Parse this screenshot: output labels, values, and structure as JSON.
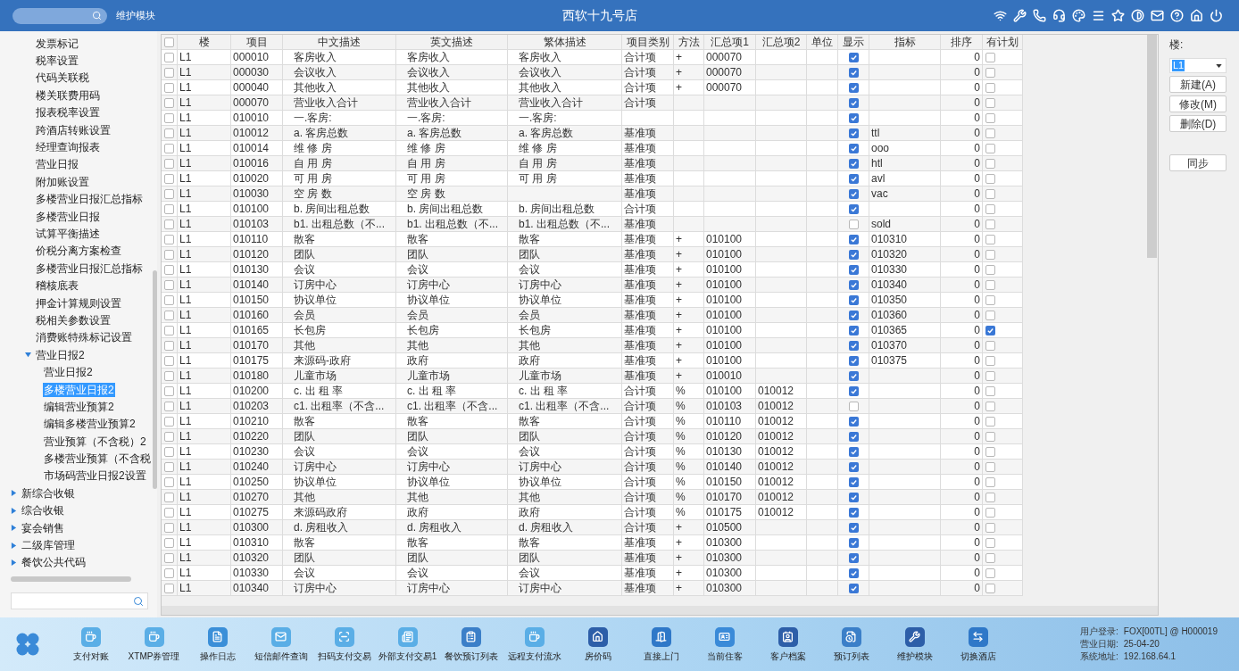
{
  "top_bar": {
    "module": "维护模块",
    "title": "西软十九号店"
  },
  "sidebar": {
    "items": [
      {
        "label": "发票标记",
        "selected": false
      },
      {
        "label": "税率设置",
        "selected": false
      },
      {
        "label": "代码关联税",
        "selected": false
      },
      {
        "label": "楼关联费用码",
        "selected": false
      },
      {
        "label": "报表税率设置",
        "selected": false
      },
      {
        "label": "跨酒店转账设置",
        "selected": false
      },
      {
        "label": "经理查询报表",
        "selected": false
      },
      {
        "label": "营业日报",
        "selected": false
      },
      {
        "label": "附加账设置",
        "selected": false
      },
      {
        "label": "多楼营业日报汇总指标",
        "selected": false
      },
      {
        "label": "多楼营业日报",
        "selected": false
      },
      {
        "label": "试算平衡描述",
        "selected": false
      },
      {
        "label": "价税分离方案检查",
        "selected": false
      },
      {
        "label": "多楼营业日报汇总指标",
        "selected": false
      },
      {
        "label": "稽核底表",
        "selected": false
      },
      {
        "label": "押金计算规则设置",
        "selected": false
      },
      {
        "label": "税相关参数设置",
        "selected": false
      },
      {
        "label": "消费账特殊标记设置",
        "selected": false
      },
      {
        "label": "营业日报2",
        "selected": false,
        "expanded": true,
        "children": [
          {
            "label": "营业日报2",
            "selected": false
          },
          {
            "label": "多楼营业日报2",
            "selected": true
          },
          {
            "label": "编辑营业预算2",
            "selected": false
          },
          {
            "label": "编辑多楼营业预算2",
            "selected": false
          },
          {
            "label": "营业预算（不含税）2",
            "selected": false
          },
          {
            "label": "多楼营业预算（不含税",
            "selected": false
          },
          {
            "label": "市场码营业日报2设置",
            "selected": false
          }
        ]
      }
    ],
    "sections": [
      {
        "label": "新综合收银",
        "selected": false,
        "expanded": false
      },
      {
        "label": "综合收银",
        "selected": false,
        "expanded": false
      },
      {
        "label": "宴会销售",
        "selected": false,
        "expanded": false
      },
      {
        "label": "二级库管理",
        "selected": false,
        "expanded": false
      },
      {
        "label": "餐饮公共代码",
        "selected": false,
        "expanded": false
      }
    ]
  },
  "table": {
    "header_checked": false,
    "columns": [
      "楼",
      "项目",
      "中文描述",
      "英文描述",
      "繁体描述",
      "项目类别",
      "方法",
      "汇总项1",
      "汇总项2",
      "单位",
      "显示",
      "指标",
      "排序",
      "有计划"
    ],
    "rows": [
      {
        "checked": false,
        "floor": "L1",
        "code": "000010",
        "zh": "客房收入",
        "en": "客房收入",
        "tw": "客房收入",
        "category": "合计项",
        "method": "+",
        "sum1": "000070",
        "sum2": "",
        "show": true,
        "index": "",
        "sort": "0",
        "plan": false
      },
      {
        "checked": false,
        "floor": "L1",
        "code": "000030",
        "zh": "会议收入",
        "en": "会议收入",
        "tw": "会议收入",
        "category": "合计项",
        "method": "+",
        "sum1": "000070",
        "sum2": "",
        "show": true,
        "index": "",
        "sort": "0",
        "plan": false
      },
      {
        "checked": false,
        "floor": "L1",
        "code": "000040",
        "zh": "其他收入",
        "en": "其他收入",
        "tw": "其他收入",
        "category": "合计项",
        "method": "+",
        "sum1": "000070",
        "sum2": "",
        "show": true,
        "index": "",
        "sort": "0",
        "plan": false
      },
      {
        "checked": false,
        "floor": "L1",
        "code": "000070",
        "zh": "营业收入合计",
        "en": "营业收入合计",
        "tw": "营业收入合计",
        "category": "合计项",
        "method": "",
        "sum1": "",
        "sum2": "",
        "show": true,
        "index": "",
        "sort": "0",
        "plan": false
      },
      {
        "checked": false,
        "floor": "L1",
        "code": "010010",
        "zh": "一.客房:",
        "en": "一.客房:",
        "tw": "一.客房:",
        "category": "",
        "method": "",
        "sum1": "",
        "sum2": "",
        "show": true,
        "index": "",
        "sort": "0",
        "plan": false
      },
      {
        "checked": false,
        "floor": "L1",
        "code": "010012",
        "zh": "a. 客房总数",
        "en": "a. 客房总数",
        "tw": "a. 客房总数",
        "category": "基准项",
        "method": "",
        "sum1": "",
        "sum2": "",
        "show": true,
        "index": "ttl",
        "sort": "0",
        "plan": false
      },
      {
        "checked": false,
        "floor": "L1",
        "code": "010014",
        "zh": "维 修 房",
        "en": "维 修 房",
        "tw": "维 修 房",
        "category": "基准项",
        "method": "",
        "sum1": "",
        "sum2": "",
        "show": true,
        "index": "ooo",
        "sort": "0",
        "plan": false
      },
      {
        "checked": false,
        "floor": "L1",
        "code": "010016",
        "zh": "自 用 房",
        "en": "自 用 房",
        "tw": "自 用 房",
        "category": "基准项",
        "method": "",
        "sum1": "",
        "sum2": "",
        "show": true,
        "index": "htl",
        "sort": "0",
        "plan": false
      },
      {
        "checked": false,
        "floor": "L1",
        "code": "010020",
        "zh": "可 用 房",
        "en": "可 用 房",
        "tw": "可 用 房",
        "category": "基准项",
        "method": "",
        "sum1": "",
        "sum2": "",
        "show": true,
        "index": "avl",
        "sort": "0",
        "plan": false
      },
      {
        "checked": false,
        "floor": "L1",
        "code": "010030",
        "zh": "空 房 数",
        "en": "空 房 数",
        "tw": "",
        "category": "基准项",
        "method": "",
        "sum1": "",
        "sum2": "",
        "show": true,
        "index": "vac",
        "sort": "0",
        "plan": false
      },
      {
        "checked": false,
        "floor": "L1",
        "code": "010100",
        "zh": "b. 房间出租总数",
        "en": "b. 房间出租总数",
        "tw": "b. 房间出租总数",
        "category": "合计项",
        "method": "",
        "sum1": "",
        "sum2": "",
        "show": true,
        "index": "",
        "sort": "0",
        "plan": false
      },
      {
        "checked": false,
        "floor": "L1",
        "code": "010103",
        "zh": "b1. 出租总数（不...",
        "en": "b1. 出租总数（不...",
        "tw": "b1. 出租总数（不...",
        "category": "基准项",
        "method": "",
        "sum1": "",
        "sum2": "",
        "show": false,
        "index": "sold",
        "sort": "0",
        "plan": false
      },
      {
        "checked": false,
        "floor": "L1",
        "code": "010110",
        "zh": "散客",
        "en": "散客",
        "tw": "散客",
        "category": "基准项",
        "method": "+",
        "sum1": "010100",
        "sum2": "",
        "show": true,
        "index": "010310",
        "sort": "0",
        "plan": false
      },
      {
        "checked": false,
        "floor": "L1",
        "code": "010120",
        "zh": "团队",
        "en": "团队",
        "tw": "团队",
        "category": "基准项",
        "method": "+",
        "sum1": "010100",
        "sum2": "",
        "show": true,
        "index": "010320",
        "sort": "0",
        "plan": false
      },
      {
        "checked": false,
        "floor": "L1",
        "code": "010130",
        "zh": "会议",
        "en": "会议",
        "tw": "会议",
        "category": "基准项",
        "method": "+",
        "sum1": "010100",
        "sum2": "",
        "show": true,
        "index": "010330",
        "sort": "0",
        "plan": false
      },
      {
        "checked": false,
        "floor": "L1",
        "code": "010140",
        "zh": "订房中心",
        "en": "订房中心",
        "tw": "订房中心",
        "category": "基准项",
        "method": "+",
        "sum1": "010100",
        "sum2": "",
        "show": true,
        "index": "010340",
        "sort": "0",
        "plan": false
      },
      {
        "checked": false,
        "floor": "L1",
        "code": "010150",
        "zh": "协议单位",
        "en": "协议单位",
        "tw": "协议单位",
        "category": "基准项",
        "method": "+",
        "sum1": "010100",
        "sum2": "",
        "show": true,
        "index": "010350",
        "sort": "0",
        "plan": false
      },
      {
        "checked": false,
        "floor": "L1",
        "code": "010160",
        "zh": "会员",
        "en": "会员",
        "tw": "会员",
        "category": "基准项",
        "method": "+",
        "sum1": "010100",
        "sum2": "",
        "show": true,
        "index": "010360",
        "sort": "0",
        "plan": false
      },
      {
        "checked": false,
        "floor": "L1",
        "code": "010165",
        "zh": "长包房",
        "en": "长包房",
        "tw": "长包房",
        "category": "基准项",
        "method": "+",
        "sum1": "010100",
        "sum2": "",
        "show": true,
        "index": "010365",
        "sort": "0",
        "plan": true
      },
      {
        "checked": false,
        "floor": "L1",
        "code": "010170",
        "zh": "其他",
        "en": "其他",
        "tw": "其他",
        "category": "基准项",
        "method": "+",
        "sum1": "010100",
        "sum2": "",
        "show": true,
        "index": "010370",
        "sort": "0",
        "plan": false
      },
      {
        "checked": false,
        "floor": "L1",
        "code": "010175",
        "zh": "来源码-政府",
        "en": "政府",
        "tw": "政府",
        "category": "基准项",
        "method": "+",
        "sum1": "010100",
        "sum2": "",
        "show": true,
        "index": "010375",
        "sort": "0",
        "plan": false
      },
      {
        "checked": false,
        "floor": "L1",
        "code": "010180",
        "zh": "儿童市场",
        "en": "儿童市场",
        "tw": "儿童市场",
        "category": "基准项",
        "method": "+",
        "sum1": "010010",
        "sum2": "",
        "show": true,
        "index": "",
        "sort": "0",
        "plan": false
      },
      {
        "checked": false,
        "floor": "L1",
        "code": "010200",
        "zh": "c. 出 租 率",
        "en": "c. 出 租 率",
        "tw": "c. 出 租 率",
        "category": "合计项",
        "method": "%",
        "sum1": "010100",
        "sum2": "010012",
        "show": true,
        "index": "",
        "sort": "0",
        "plan": false
      },
      {
        "checked": false,
        "floor": "L1",
        "code": "010203",
        "zh": "c1. 出租率（不含...",
        "en": "c1. 出租率（不含...",
        "tw": "c1. 出租率（不含...",
        "category": "合计项",
        "method": "%",
        "sum1": "010103",
        "sum2": "010012",
        "show": false,
        "index": "",
        "sort": "0",
        "plan": false
      },
      {
        "checked": false,
        "floor": "L1",
        "code": "010210",
        "zh": "散客",
        "en": "散客",
        "tw": "散客",
        "category": "合计项",
        "method": "%",
        "sum1": "010110",
        "sum2": "010012",
        "show": true,
        "index": "",
        "sort": "0",
        "plan": false
      },
      {
        "checked": false,
        "floor": "L1",
        "code": "010220",
        "zh": "团队",
        "en": "团队",
        "tw": "团队",
        "category": "合计项",
        "method": "%",
        "sum1": "010120",
        "sum2": "010012",
        "show": true,
        "index": "",
        "sort": "0",
        "plan": false
      },
      {
        "checked": false,
        "floor": "L1",
        "code": "010230",
        "zh": "会议",
        "en": "会议",
        "tw": "会议",
        "category": "合计项",
        "method": "%",
        "sum1": "010130",
        "sum2": "010012",
        "show": true,
        "index": "",
        "sort": "0",
        "plan": false
      },
      {
        "checked": false,
        "floor": "L1",
        "code": "010240",
        "zh": "订房中心",
        "en": "订房中心",
        "tw": "订房中心",
        "category": "合计项",
        "method": "%",
        "sum1": "010140",
        "sum2": "010012",
        "show": true,
        "index": "",
        "sort": "0",
        "plan": false
      },
      {
        "checked": false,
        "floor": "L1",
        "code": "010250",
        "zh": "协议单位",
        "en": "协议单位",
        "tw": "协议单位",
        "category": "合计项",
        "method": "%",
        "sum1": "010150",
        "sum2": "010012",
        "show": true,
        "index": "",
        "sort": "0",
        "plan": false
      },
      {
        "checked": false,
        "floor": "L1",
        "code": "010270",
        "zh": "其他",
        "en": "其他",
        "tw": "其他",
        "category": "合计项",
        "method": "%",
        "sum1": "010170",
        "sum2": "010012",
        "show": true,
        "index": "",
        "sort": "0",
        "plan": false
      },
      {
        "checked": false,
        "floor": "L1",
        "code": "010275",
        "zh": "来源码政府",
        "en": "政府",
        "tw": "政府",
        "category": "合计项",
        "method": "%",
        "sum1": "010175",
        "sum2": "010012",
        "show": true,
        "index": "",
        "sort": "0",
        "plan": false
      },
      {
        "checked": false,
        "floor": "L1",
        "code": "010300",
        "zh": "d. 房租收入",
        "en": "d. 房租收入",
        "tw": "d. 房租收入",
        "category": "合计项",
        "method": "+",
        "sum1": "010500",
        "sum2": "",
        "show": true,
        "index": "",
        "sort": "0",
        "plan": false
      },
      {
        "checked": false,
        "floor": "L1",
        "code": "010310",
        "zh": "散客",
        "en": "散客",
        "tw": "散客",
        "category": "基准项",
        "method": "+",
        "sum1": "010300",
        "sum2": "",
        "show": true,
        "index": "",
        "sort": "0",
        "plan": false
      },
      {
        "checked": false,
        "floor": "L1",
        "code": "010320",
        "zh": "团队",
        "en": "团队",
        "tw": "团队",
        "category": "基准项",
        "method": "+",
        "sum1": "010300",
        "sum2": "",
        "show": true,
        "index": "",
        "sort": "0",
        "plan": false
      },
      {
        "checked": false,
        "floor": "L1",
        "code": "010330",
        "zh": "会议",
        "en": "会议",
        "tw": "会议",
        "category": "基准项",
        "method": "+",
        "sum1": "010300",
        "sum2": "",
        "show": true,
        "index": "",
        "sort": "0",
        "plan": false
      },
      {
        "checked": false,
        "floor": "L1",
        "code": "010340",
        "zh": "订房中心",
        "en": "订房中心",
        "tw": "订房中心",
        "category": "基准项",
        "method": "+",
        "sum1": "010300",
        "sum2": "",
        "show": true,
        "index": "",
        "sort": "0",
        "plan": false
      }
    ]
  },
  "right_panel": {
    "floor_label": "楼:",
    "floor_value": "L1",
    "buttons": [
      "新建(A)",
      "修改(M)",
      "删除(D)"
    ],
    "sync_button": "同步"
  },
  "bottom_bar": {
    "items": [
      {
        "label": "支付对账",
        "color": "#5aaee6"
      },
      {
        "label": "XTMP券管理",
        "color": "#5aaee6"
      },
      {
        "label": "操作日志",
        "color": "#3b8fd8"
      },
      {
        "label": "短信邮件查询",
        "color": "#5aaee6"
      },
      {
        "label": "扫码支付交易",
        "color": "#5aaee6"
      },
      {
        "label": "外部支付交易1",
        "color": "#5aaee6"
      },
      {
        "label": "餐饮预订列表",
        "color": "#3b7fc8"
      },
      {
        "label": "远程支付流水",
        "color": "#5aaee6"
      },
      {
        "label": "房价码",
        "color": "#2d5ea8"
      },
      {
        "label": "直接上门",
        "color": "#2f78c8"
      },
      {
        "label": "当前住客",
        "color": "#3a8ad8"
      },
      {
        "label": "客户档案",
        "color": "#2d5ea8"
      },
      {
        "label": "预订列表",
        "color": "#3b7fc8"
      },
      {
        "label": "维护模块",
        "color": "#2d5ea8"
      },
      {
        "label": "切换酒店",
        "color": "#2f78c8"
      }
    ],
    "status": [
      "用户登录:",
      "FOX[00TL] @ H000019",
      "营业日期:",
      "25-04-20",
      "系统地址:",
      "192.168.64.1"
    ]
  }
}
